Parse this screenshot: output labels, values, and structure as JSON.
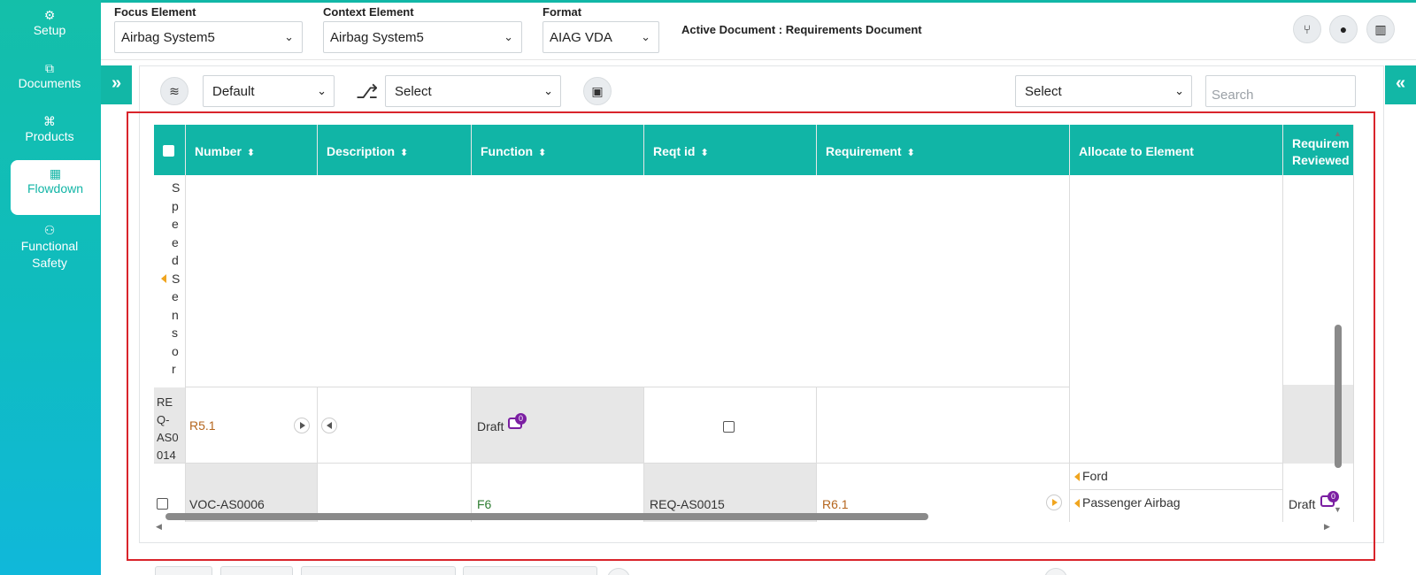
{
  "sidebar": {
    "items": [
      {
        "label": "Setup",
        "icon": "gears-icon",
        "glyph": "⚙"
      },
      {
        "label": "Documents",
        "icon": "documents-icon",
        "glyph": "⧉"
      },
      {
        "label": "Products",
        "icon": "products-icon",
        "glyph": "⌘"
      },
      {
        "label": "Flowdown",
        "icon": "flowdown-icon",
        "glyph": "▦",
        "active": true
      },
      {
        "label": "Functional Safety",
        "icon": "functional-safety-icon",
        "glyph": "⚇"
      }
    ]
  },
  "header": {
    "focus_label": "Focus Element",
    "focus_value": "Airbag System5",
    "context_label": "Context Element",
    "context_value": "Airbag System5",
    "format_label": "Format",
    "format_value": "AIAG VDA",
    "active_document": "Active Document : Requirements Document",
    "buttons": [
      {
        "icon": "branch-icon",
        "glyph": "⑂"
      },
      {
        "icon": "drop-icon",
        "glyph": "●"
      },
      {
        "icon": "bar-chart-icon",
        "glyph": "▥"
      }
    ]
  },
  "toolbar": {
    "layer_glyph": "≋",
    "view_value": "Default",
    "flow_glyph": "⎇",
    "select1_value": "Select",
    "image_glyph": "▣",
    "select2_value": "Select",
    "search_placeholder": "Search",
    "expand_left": "»",
    "expand_right": "«"
  },
  "table": {
    "columns": [
      {
        "label": "Number",
        "sortable": true
      },
      {
        "label": "Description",
        "sortable": true
      },
      {
        "label": "Function",
        "sortable": true
      },
      {
        "label": "Reqt id",
        "sortable": true
      },
      {
        "label": "Requirement",
        "sortable": true
      },
      {
        "label": "Allocate to Element",
        "sortable": false
      },
      {
        "label": "Requirem Reviewed",
        "sortable": false
      }
    ],
    "sort_glyph": "⬍",
    "vertical_label": [
      "S",
      "p",
      "e",
      "e",
      "d",
      "S",
      "e",
      "n",
      "s",
      "o",
      "r"
    ],
    "row1": {
      "id_lines": [
        "RE",
        "Q-",
        "AS0",
        "014"
      ],
      "number": "R5.1",
      "function_status": "Draft",
      "comment_count": "0"
    },
    "row2": {
      "number": "VOC-AS0006",
      "function": "F6",
      "reqt_id": "REQ-AS0015",
      "requirement": "R6.1",
      "allocations": [
        "Ford",
        "Passenger Airbag"
      ],
      "reviewed_status": "Draft",
      "comment_count": "0"
    }
  },
  "colors": {
    "accent": "#11b5a6",
    "link_orange": "#b5651d",
    "function_green": "#2e7d32",
    "badge_purple": "#7b1fa2",
    "highlight_red": "#d9242b"
  }
}
